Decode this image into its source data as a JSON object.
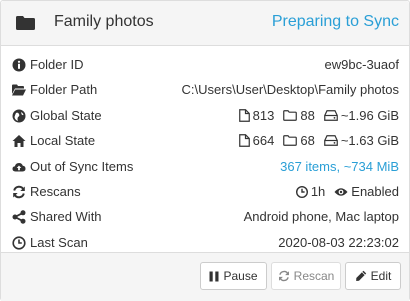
{
  "panel": {
    "title": "Family photos",
    "status": "Preparing to Sync",
    "status_color": "#2a9fd6",
    "icon": "folder-icon"
  },
  "rows": [
    {
      "icon": "info-icon",
      "label": "Folder ID",
      "value": "ew9bc-3uaof"
    },
    {
      "icon": "folder-open-icon",
      "label": "Folder Path",
      "value": "C:\\Users\\User\\Desktop\\Family photos"
    },
    {
      "icon": "globe-icon",
      "label": "Global State",
      "files": "813",
      "folders": "88",
      "size": "~1.96 GiB"
    },
    {
      "icon": "home-icon",
      "label": "Local State",
      "files": "664",
      "folders": "68",
      "size": "~1.63 GiB"
    },
    {
      "icon": "cloud-upload-icon",
      "label": "Out of Sync Items",
      "value": "367 items, ~734 MiB",
      "value_color": "#2a9fd6"
    },
    {
      "icon": "refresh-icon",
      "label": "Rescans",
      "interval": "1h",
      "watch": "Enabled"
    },
    {
      "icon": "share-icon",
      "label": "Shared With",
      "value": "Android phone, Mac laptop"
    },
    {
      "icon": "clock-icon",
      "label": "Last Scan",
      "value": "2020-08-03 22:23:02"
    }
  ],
  "buttons": {
    "pause": "Pause",
    "rescan": "Rescan",
    "edit": "Edit"
  }
}
